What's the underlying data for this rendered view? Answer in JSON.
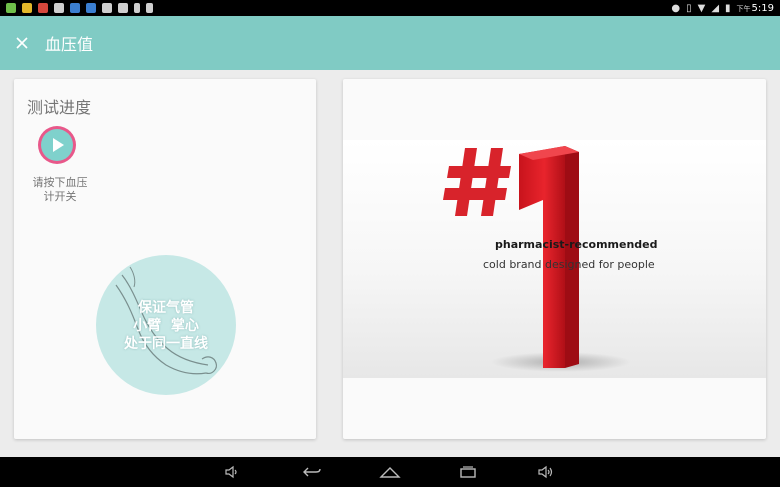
{
  "status_bar": {
    "left_icons": [
      "app-icon",
      "settings-icon",
      "message-icon",
      "image-icon",
      "browser-icon",
      "globe-icon",
      "video-icon",
      "blocked-icon",
      "usb-icon",
      "sd-card-icon"
    ],
    "right_icons": [
      "location-icon",
      "vibrate-icon",
      "wifi-icon",
      "signal-icon",
      "battery-icon"
    ],
    "ampm": "下午",
    "time": "5:19"
  },
  "app_bar": {
    "title": "血压值",
    "color": "#80cbc4"
  },
  "progress_card": {
    "title": "测试进度",
    "instruction": [
      "请按下血压",
      "计开关"
    ],
    "guide": {
      "lines": [
        "保证气管",
        "小臂  掌心",
        "处于同一直线"
      ]
    }
  },
  "ad": {
    "big_text": "#1",
    "line1": "pharmacist-recommended",
    "line2": "cold brand designed for people"
  },
  "nav_bar": {
    "buttons": [
      "volume-down-icon",
      "back-icon",
      "home-icon",
      "recents-icon",
      "volume-up-icon"
    ]
  }
}
